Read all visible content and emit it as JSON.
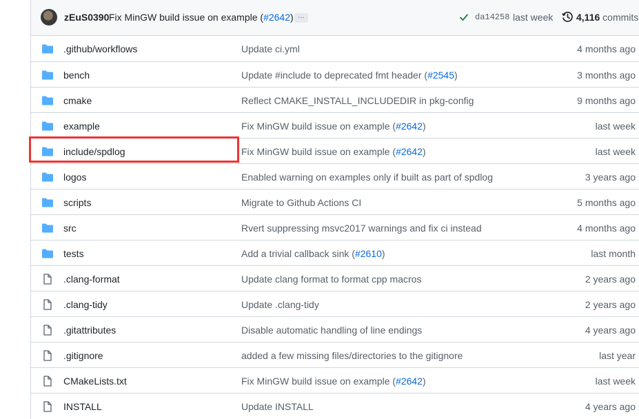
{
  "latest_commit": {
    "author": "zEuS0390",
    "message_prefix": "Fix MinGW build issue on example (",
    "pr_link": "#2642",
    "message_suffix": ")",
    "ellipsis": "…",
    "sha": "da14258",
    "date": "last week",
    "commit_count": "4,116",
    "commits_label": "commits"
  },
  "files": [
    {
      "type": "dir",
      "name": ".github/workflows",
      "msg": "Update ci.yml",
      "pr": "",
      "suffix": "",
      "age": "4 months ago"
    },
    {
      "type": "dir",
      "name": "bench",
      "msg": "Update #include to deprecated fmt header (",
      "pr": "#2545",
      "suffix": ")",
      "age": "3 months ago"
    },
    {
      "type": "dir",
      "name": "cmake",
      "msg": "Reflect CMAKE_INSTALL_INCLUDEDIR in pkg-config",
      "pr": "",
      "suffix": "",
      "age": "9 months ago"
    },
    {
      "type": "dir",
      "name": "example",
      "msg": "Fix MinGW build issue on example (",
      "pr": "#2642",
      "suffix": ")",
      "age": "last week"
    },
    {
      "type": "dir",
      "name": "include/spdlog",
      "msg": "Fix MinGW build issue on example (",
      "pr": "#2642",
      "suffix": ")",
      "age": "last week"
    },
    {
      "type": "dir",
      "name": "logos",
      "msg": "Enabled warning on examples only if built as part of spdlog",
      "pr": "",
      "suffix": "",
      "age": "3 years ago"
    },
    {
      "type": "dir",
      "name": "scripts",
      "msg": "Migrate to Github Actions CI",
      "pr": "",
      "suffix": "",
      "age": "5 months ago"
    },
    {
      "type": "dir",
      "name": "src",
      "msg": "Rvert suppressing msvc2017 warnings and fix ci instead",
      "pr": "",
      "suffix": "",
      "age": "4 months ago"
    },
    {
      "type": "dir",
      "name": "tests",
      "msg": "Add a trivial callback sink (",
      "pr": "#2610",
      "suffix": ")",
      "age": "last month"
    },
    {
      "type": "file",
      "name": ".clang-format",
      "msg": "Update clang format to format cpp macros",
      "pr": "",
      "suffix": "",
      "age": "2 years ago"
    },
    {
      "type": "file",
      "name": ".clang-tidy",
      "msg": "Update .clang-tidy",
      "pr": "",
      "suffix": "",
      "age": "2 years ago"
    },
    {
      "type": "file",
      "name": ".gitattributes",
      "msg": "Disable automatic handling of line endings",
      "pr": "",
      "suffix": "",
      "age": "4 years ago"
    },
    {
      "type": "file",
      "name": ".gitignore",
      "msg": "added a few missing files/directories to the gitignore",
      "pr": "",
      "suffix": "",
      "age": "last year"
    },
    {
      "type": "file",
      "name": "CMakeLists.txt",
      "msg": "Fix MinGW build issue on example (",
      "pr": "#2642",
      "suffix": ")",
      "age": "last week"
    },
    {
      "type": "file",
      "name": "INSTALL",
      "msg": "Update INSTALL",
      "pr": "",
      "suffix": "",
      "age": "4 years ago"
    }
  ],
  "colors": {
    "folder": "#54aeff",
    "link": "#0969da",
    "success": "#1a7f37",
    "highlight": "#ee3333"
  }
}
